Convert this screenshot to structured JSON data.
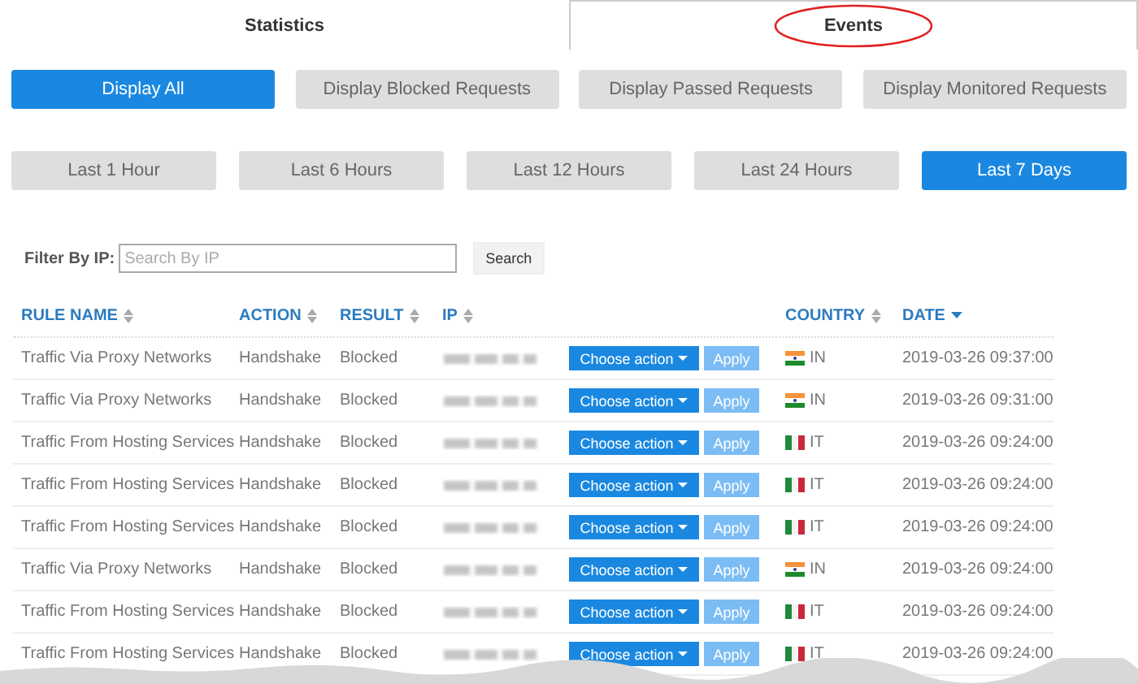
{
  "tabs": [
    {
      "label": "Statistics",
      "selected": false
    },
    {
      "label": "Events",
      "selected": true,
      "circled": true
    }
  ],
  "filters": [
    {
      "label": "Display All",
      "selected": true
    },
    {
      "label": "Display Blocked Requests",
      "selected": false
    },
    {
      "label": "Display Passed Requests",
      "selected": false
    },
    {
      "label": "Display Monitored Requests",
      "selected": false
    }
  ],
  "periods": [
    {
      "label": "Last 1 Hour",
      "selected": false
    },
    {
      "label": "Last 6 Hours",
      "selected": false
    },
    {
      "label": "Last 12 Hours",
      "selected": false
    },
    {
      "label": "Last 24 Hours",
      "selected": false
    },
    {
      "label": "Last 7 Days",
      "selected": true
    }
  ],
  "filter_by_ip": {
    "label": "Filter By IP:",
    "placeholder": "Search By IP",
    "button": "Search"
  },
  "table": {
    "columns": [
      {
        "label": "RULE NAME",
        "kind": "sortable"
      },
      {
        "label": "ACTION",
        "kind": "sortable"
      },
      {
        "label": "RESULT",
        "kind": "sortable"
      },
      {
        "label": "IP",
        "kind": "sortable"
      },
      {
        "kind": "plain"
      },
      {
        "label": "COUNTRY",
        "kind": "sortable"
      },
      {
        "label": "DATE",
        "kind": "sorted"
      }
    ],
    "rows": [
      {
        "rule_name": "Traffic Via Proxy Networks",
        "action": "Handshake",
        "result": "Blocked",
        "choose": "Choose action",
        "apply": "Apply",
        "flag": {
          "kind": "india"
        },
        "country": "IN",
        "date": "2019-03-26 09:37:00"
      },
      {
        "rule_name": "Traffic Via Proxy Networks",
        "action": "Handshake",
        "result": "Blocked",
        "choose": "Choose action",
        "apply": "Apply",
        "flag": {
          "kind": "india"
        },
        "country": "IN",
        "date": "2019-03-26 09:31:00"
      },
      {
        "rule_name": "Traffic From Hosting Services",
        "action": "Handshake",
        "result": "Blocked",
        "choose": "Choose action",
        "apply": "Apply",
        "flag": {
          "kind": "italy"
        },
        "country": "IT",
        "date": "2019-03-26 09:24:00"
      },
      {
        "rule_name": "Traffic From Hosting Services",
        "action": "Handshake",
        "result": "Blocked",
        "choose": "Choose action",
        "apply": "Apply",
        "flag": {
          "kind": "italy"
        },
        "country": "IT",
        "date": "2019-03-26 09:24:00"
      },
      {
        "rule_name": "Traffic From Hosting Services",
        "action": "Handshake",
        "result": "Blocked",
        "choose": "Choose action",
        "apply": "Apply",
        "flag": {
          "kind": "italy"
        },
        "country": "IT",
        "date": "2019-03-26 09:24:00"
      },
      {
        "rule_name": "Traffic Via Proxy Networks",
        "action": "Handshake",
        "result": "Blocked",
        "choose": "Choose action",
        "apply": "Apply",
        "flag": {
          "kind": "india"
        },
        "country": "IN",
        "date": "2019-03-26 09:24:00"
      },
      {
        "rule_name": "Traffic From Hosting Services",
        "action": "Handshake",
        "result": "Blocked",
        "choose": "Choose action",
        "apply": "Apply",
        "flag": {
          "kind": "italy"
        },
        "country": "IT",
        "date": "2019-03-26 09:24:00"
      },
      {
        "rule_name": "Traffic From Hosting Services",
        "action": "Handshake",
        "result": "Blocked",
        "choose": "Choose action",
        "apply": "Apply",
        "flag": {
          "kind": "italy"
        },
        "country": "IT",
        "date": "2019-03-26 09:24:00"
      }
    ]
  }
}
